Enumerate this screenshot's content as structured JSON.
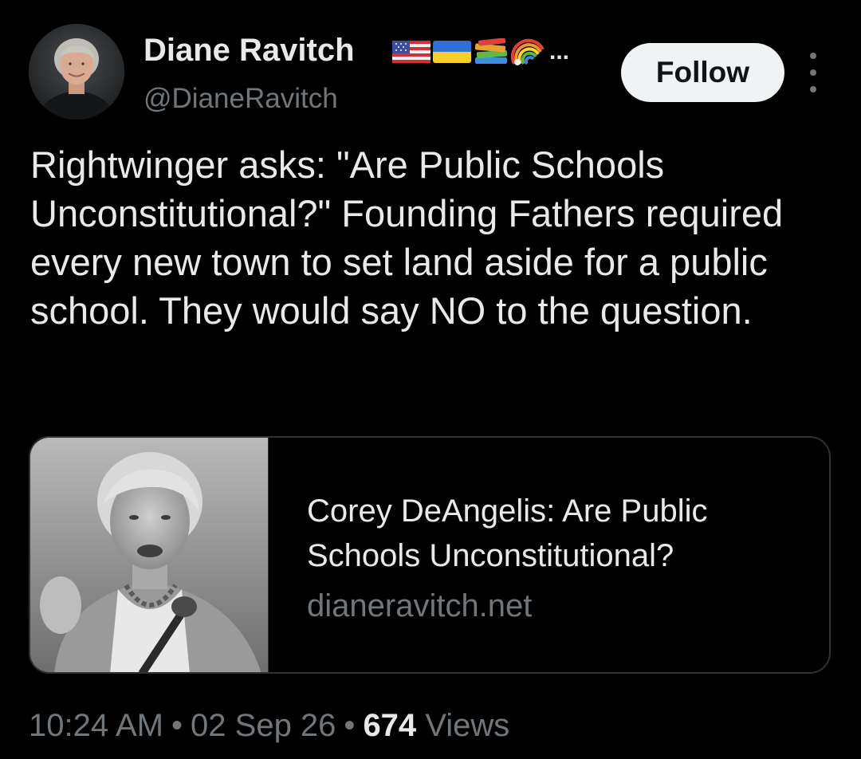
{
  "author": {
    "name": "Diane Ravitch",
    "handle": "@DianeRavitch",
    "name_emojis": [
      "us-flag-emoji",
      "ukraine-flag-emoji",
      "books-emoji",
      "rainbow-emoji"
    ],
    "name_overflow": "..."
  },
  "actions": {
    "follow_label": "Follow",
    "more_icon": "vertical-ellipsis-icon"
  },
  "tweet": {
    "text": "Rightwinger asks: \"Are Public Schools Unconstitutional?\" Founding Fathers required every new town to set land aside for a public school. They would say NO to the question."
  },
  "link_card": {
    "title": "Corey DeAngelis: Are Public Schools Unconstitutional?",
    "domain": "dianeravitch.net"
  },
  "meta": {
    "time": "10:24 AM",
    "separator": "•",
    "date": "02 Sep 26",
    "views_count": "674",
    "views_label": "Views"
  },
  "colors": {
    "background": "#000000",
    "primary_text": "#e7e9ea",
    "secondary_text": "#71767b",
    "follow_bg": "#eff3f4",
    "follow_text": "#0f1419",
    "border": "#2f3336"
  }
}
